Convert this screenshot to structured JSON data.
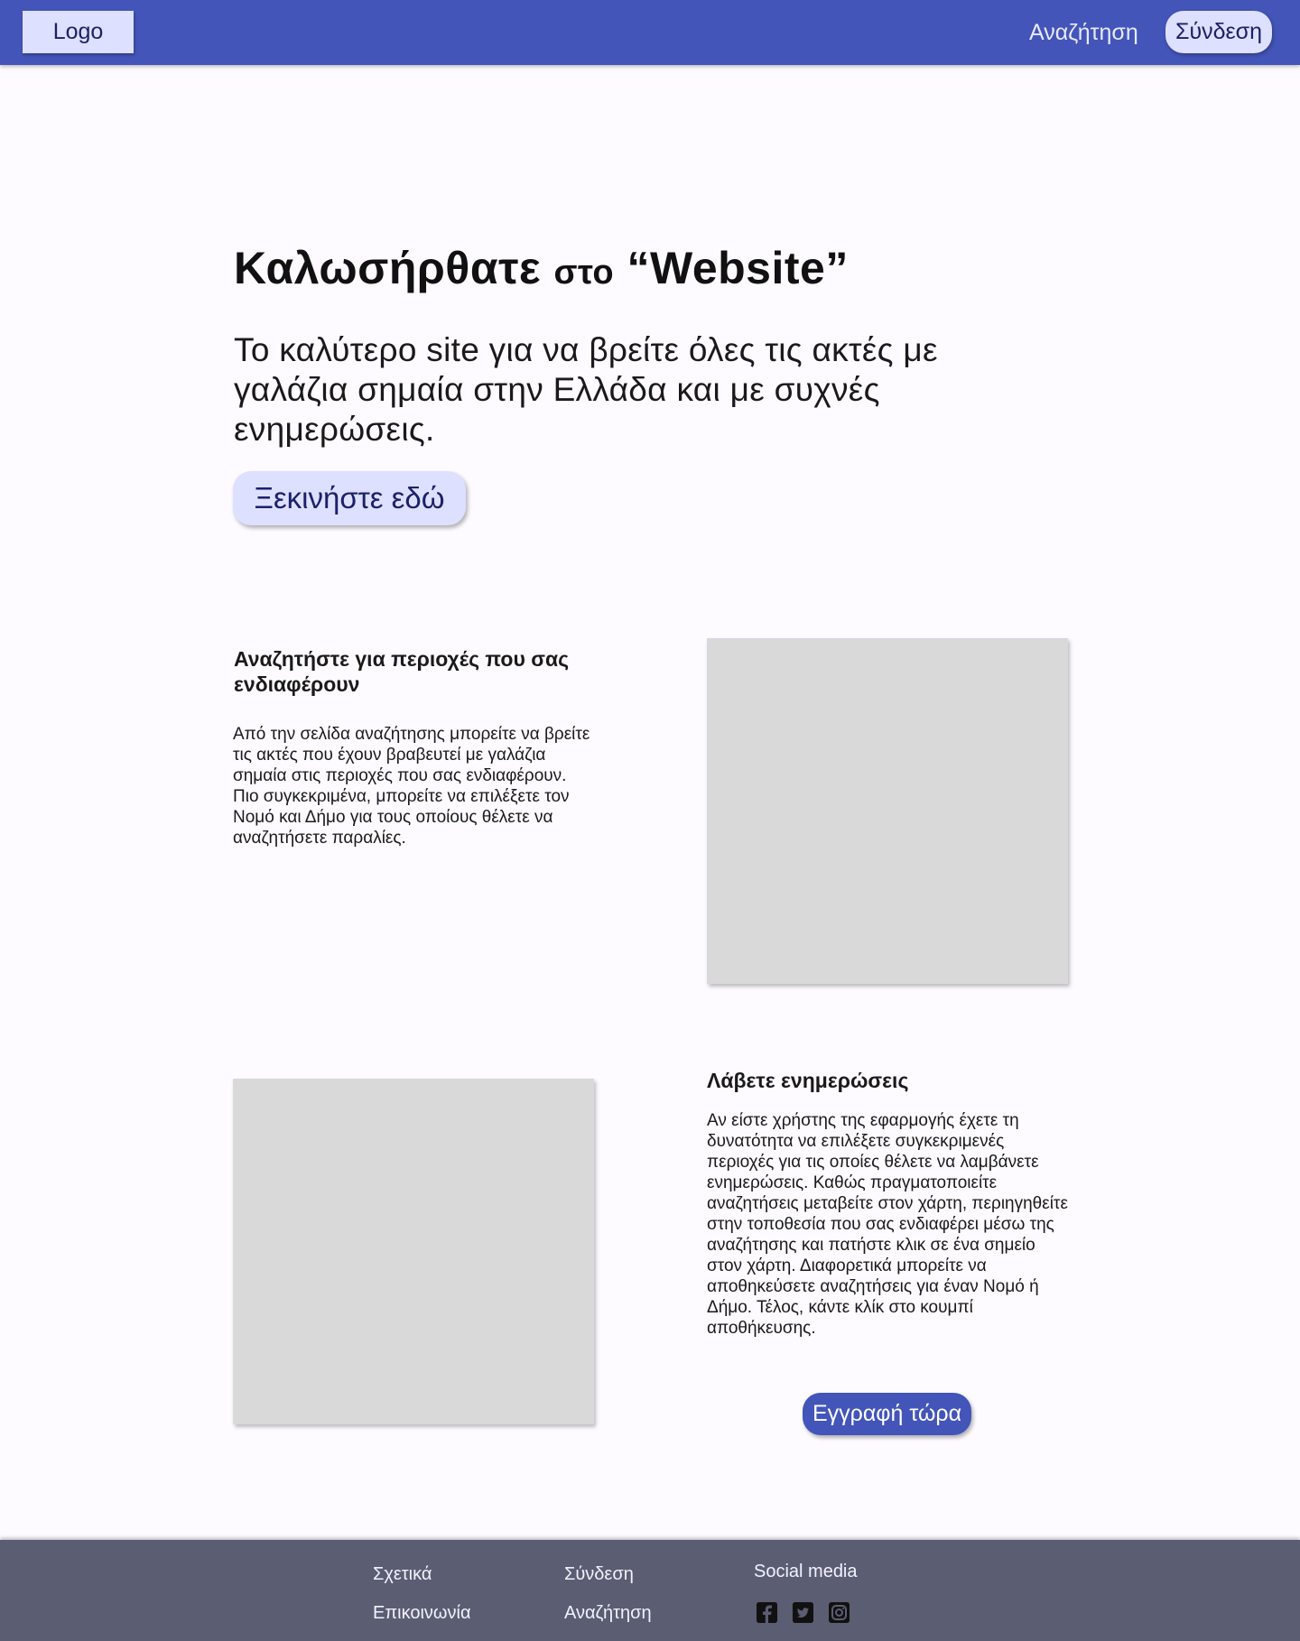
{
  "header": {
    "logo": "Logo",
    "nav_search": "Αναζήτηση",
    "nav_login": "Σύνδεση",
    "background": "#4355b9"
  },
  "hero": {
    "title_main": "Καλωσήρθατε",
    "title_small": "στο",
    "title_end": "“Website”",
    "subtitle": "Το καλύτερο site για να βρείτε όλες τις ακτές με γαλάζια σημαία στην Ελλάδα και με συχνές ενημερώσεις.",
    "cta": "Ξεκινήστε εδώ"
  },
  "feature1": {
    "title": "Αναζητήστε για περιοχές που σας ενδιαφέρουν",
    "text": "Από την σελίδα αναζήτησης μπορείτε να βρείτε τις ακτές που έχουν βραβευτεί με γαλάζια σημαία στις περιοχές που σας ενδιαφέρουν. Πιο συγκεκριμένα, μπορείτε να επιλέξετε τον Νομό και Δήμο για τους οποίους θέλετε να αναζητήσετε παραλίες."
  },
  "feature2": {
    "title": "Λάβετε ενημερώσεις",
    "text": "Αν είστε χρήστης της εφαρμογής έχετε τη δυνατότητα να επιλέξετε συγκεκριμενές περιοχές για τις οποίες θέλετε να λαμβάνετε ενημερώσεις. Καθώς πραγματοποιείτε αναζητήσεις μεταβείτε στον χάρτη, περιηγηθείτε στην τοποθεσία που σας ενδιαφέρει μέσω της αναζήτησης και πατήστε κλικ σε ένα σημείο στον χάρτη. Διαφορετικά μπορείτε να αποθηκεύσετε αναζητήσεις για έναν Νομό ή Δήμο. Τέλος,  κάντε κλίκ στο κουμπί αποθήκευσης.",
    "cta": "Εγγραφή τώρα"
  },
  "footer": {
    "about": "Σχετικά",
    "contact": "Επικοινωνία",
    "login": "Σύνδεση",
    "search": "Αναζήτηση",
    "social_title": "Social media",
    "icons": [
      "facebook-icon",
      "twitter-icon",
      "instagram-icon"
    ],
    "background": "#5b5d72"
  }
}
